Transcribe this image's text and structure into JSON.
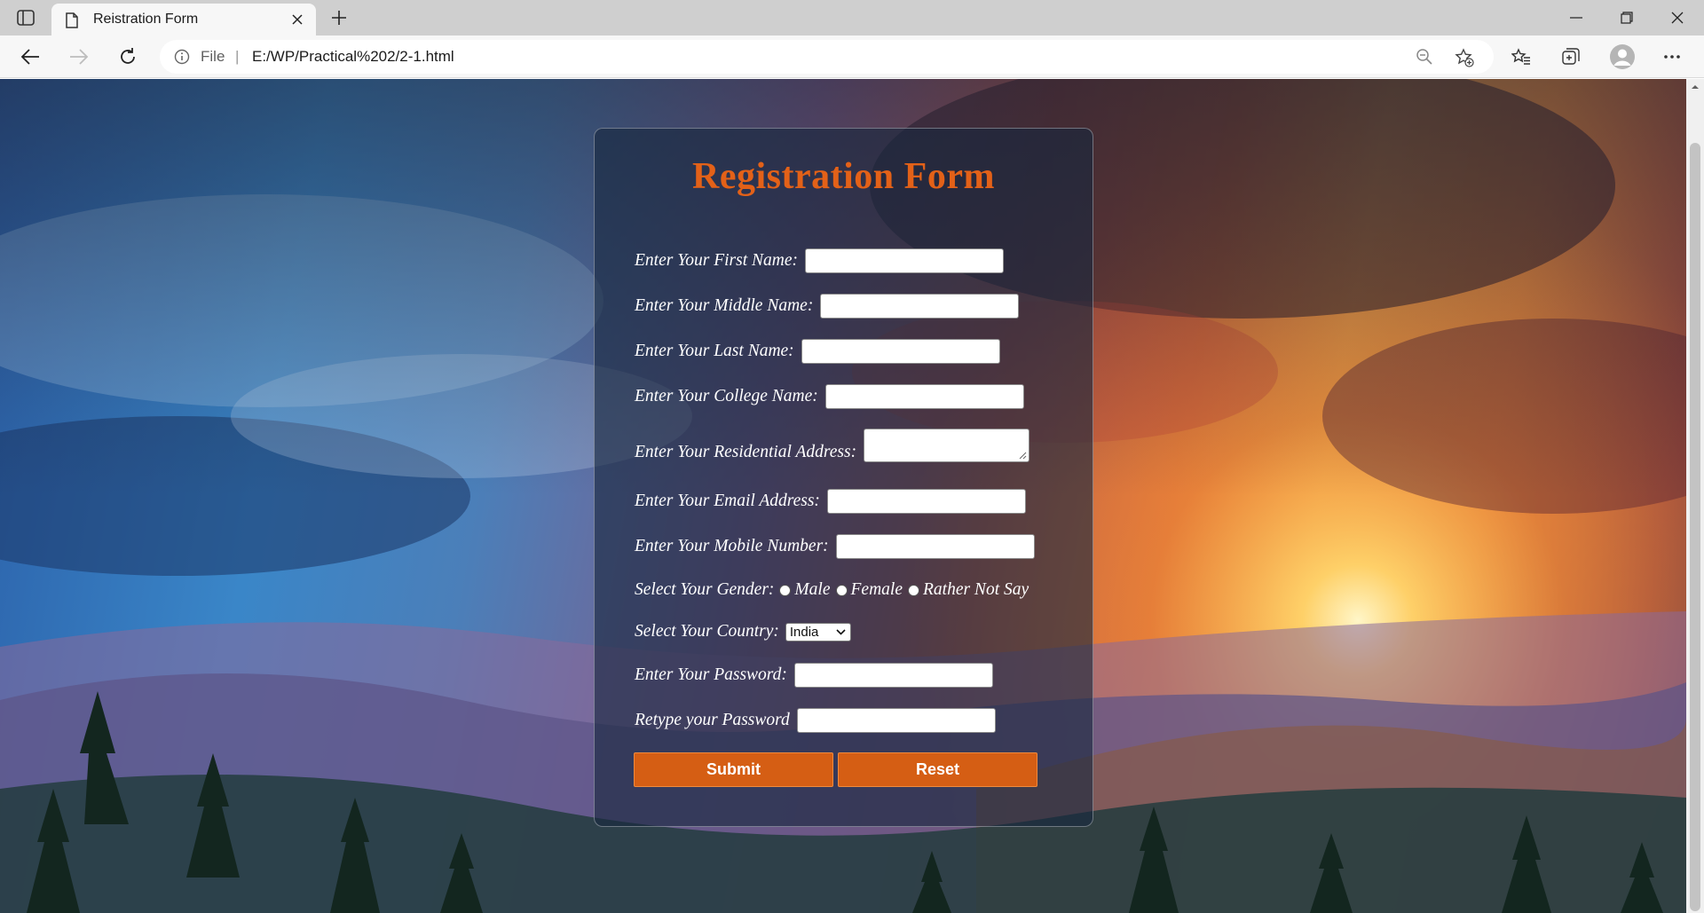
{
  "browser": {
    "tab_title": "Reistration Form",
    "address_prefix": "File",
    "url": "E:/WP/Practical%202/2-1.html"
  },
  "form": {
    "title": "Registration Form",
    "first_name_label": "Enter Your First Name:",
    "middle_name_label": "Enter Your Middle Name:",
    "last_name_label": "Enter Your Last Name:",
    "college_name_label": "Enter Your College Name:",
    "address_label": "Enter Your Residential Address:",
    "email_label": "Enter Your Email Address:",
    "mobile_label": "Enter Your Mobile Number:",
    "gender_label": "Select Your Gender:",
    "gender_options": [
      "Male",
      "Female",
      "Rather Not Say"
    ],
    "country_label": "Select Your Country:",
    "country_selected": "India",
    "password_label": "Enter Your Password:",
    "retype_password_label": "Retype your Password",
    "submit_label": "Submit",
    "reset_label": "Reset"
  },
  "colors": {
    "title": "#e36118",
    "button": "#d55e14",
    "card": "rgba(22,38,62,0.62)"
  }
}
